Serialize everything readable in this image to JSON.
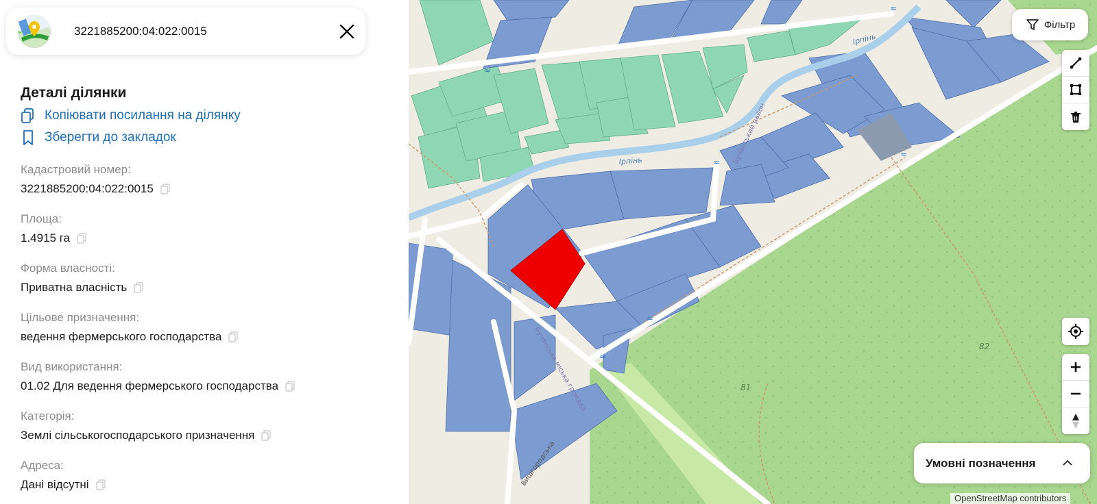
{
  "search": {
    "value": "3221885200:04:022:0015",
    "close_icon": "close-icon"
  },
  "details": {
    "title": "Деталі ділянки",
    "copy_link_label": "Копіювати посилання на ділянку",
    "bookmark_label": "Зберегти до закладок"
  },
  "fields": [
    {
      "label": "Кадастровий номер:",
      "value": "3221885200:04:022:0015"
    },
    {
      "label": "Площа:",
      "value": "1.4915 га"
    },
    {
      "label": "Форма власності:",
      "value": "Приватна власність"
    },
    {
      "label": "Цільове призначення:",
      "value": "ведення фермерського господарства"
    },
    {
      "label": "Вид використання:",
      "value": "01.02 Для ведення фермерського господарства"
    },
    {
      "label": "Категорія:",
      "value": "Землі сільськогосподарського призначення"
    },
    {
      "label": "Адреса:",
      "value": "Дані відсутні"
    }
  ],
  "map": {
    "filter_label": "Фільтр",
    "legend_label": "Умовні позначення",
    "attribution": "OpenStreetMap contributors",
    "labels": {
      "river1": "Ірпінь",
      "river2": "Ірпінь",
      "district": "Бучанський район",
      "community": "Бучанська міська громада",
      "road": "Вишгородська",
      "n81": "81",
      "n82": "82"
    },
    "colors": {
      "parcel": "#7b9bd1",
      "selected": "#ee0000",
      "allotment": "#8fd6b3",
      "forest": "#a9d78f",
      "river": "#a9cfea",
      "road": "#ffffff"
    }
  }
}
